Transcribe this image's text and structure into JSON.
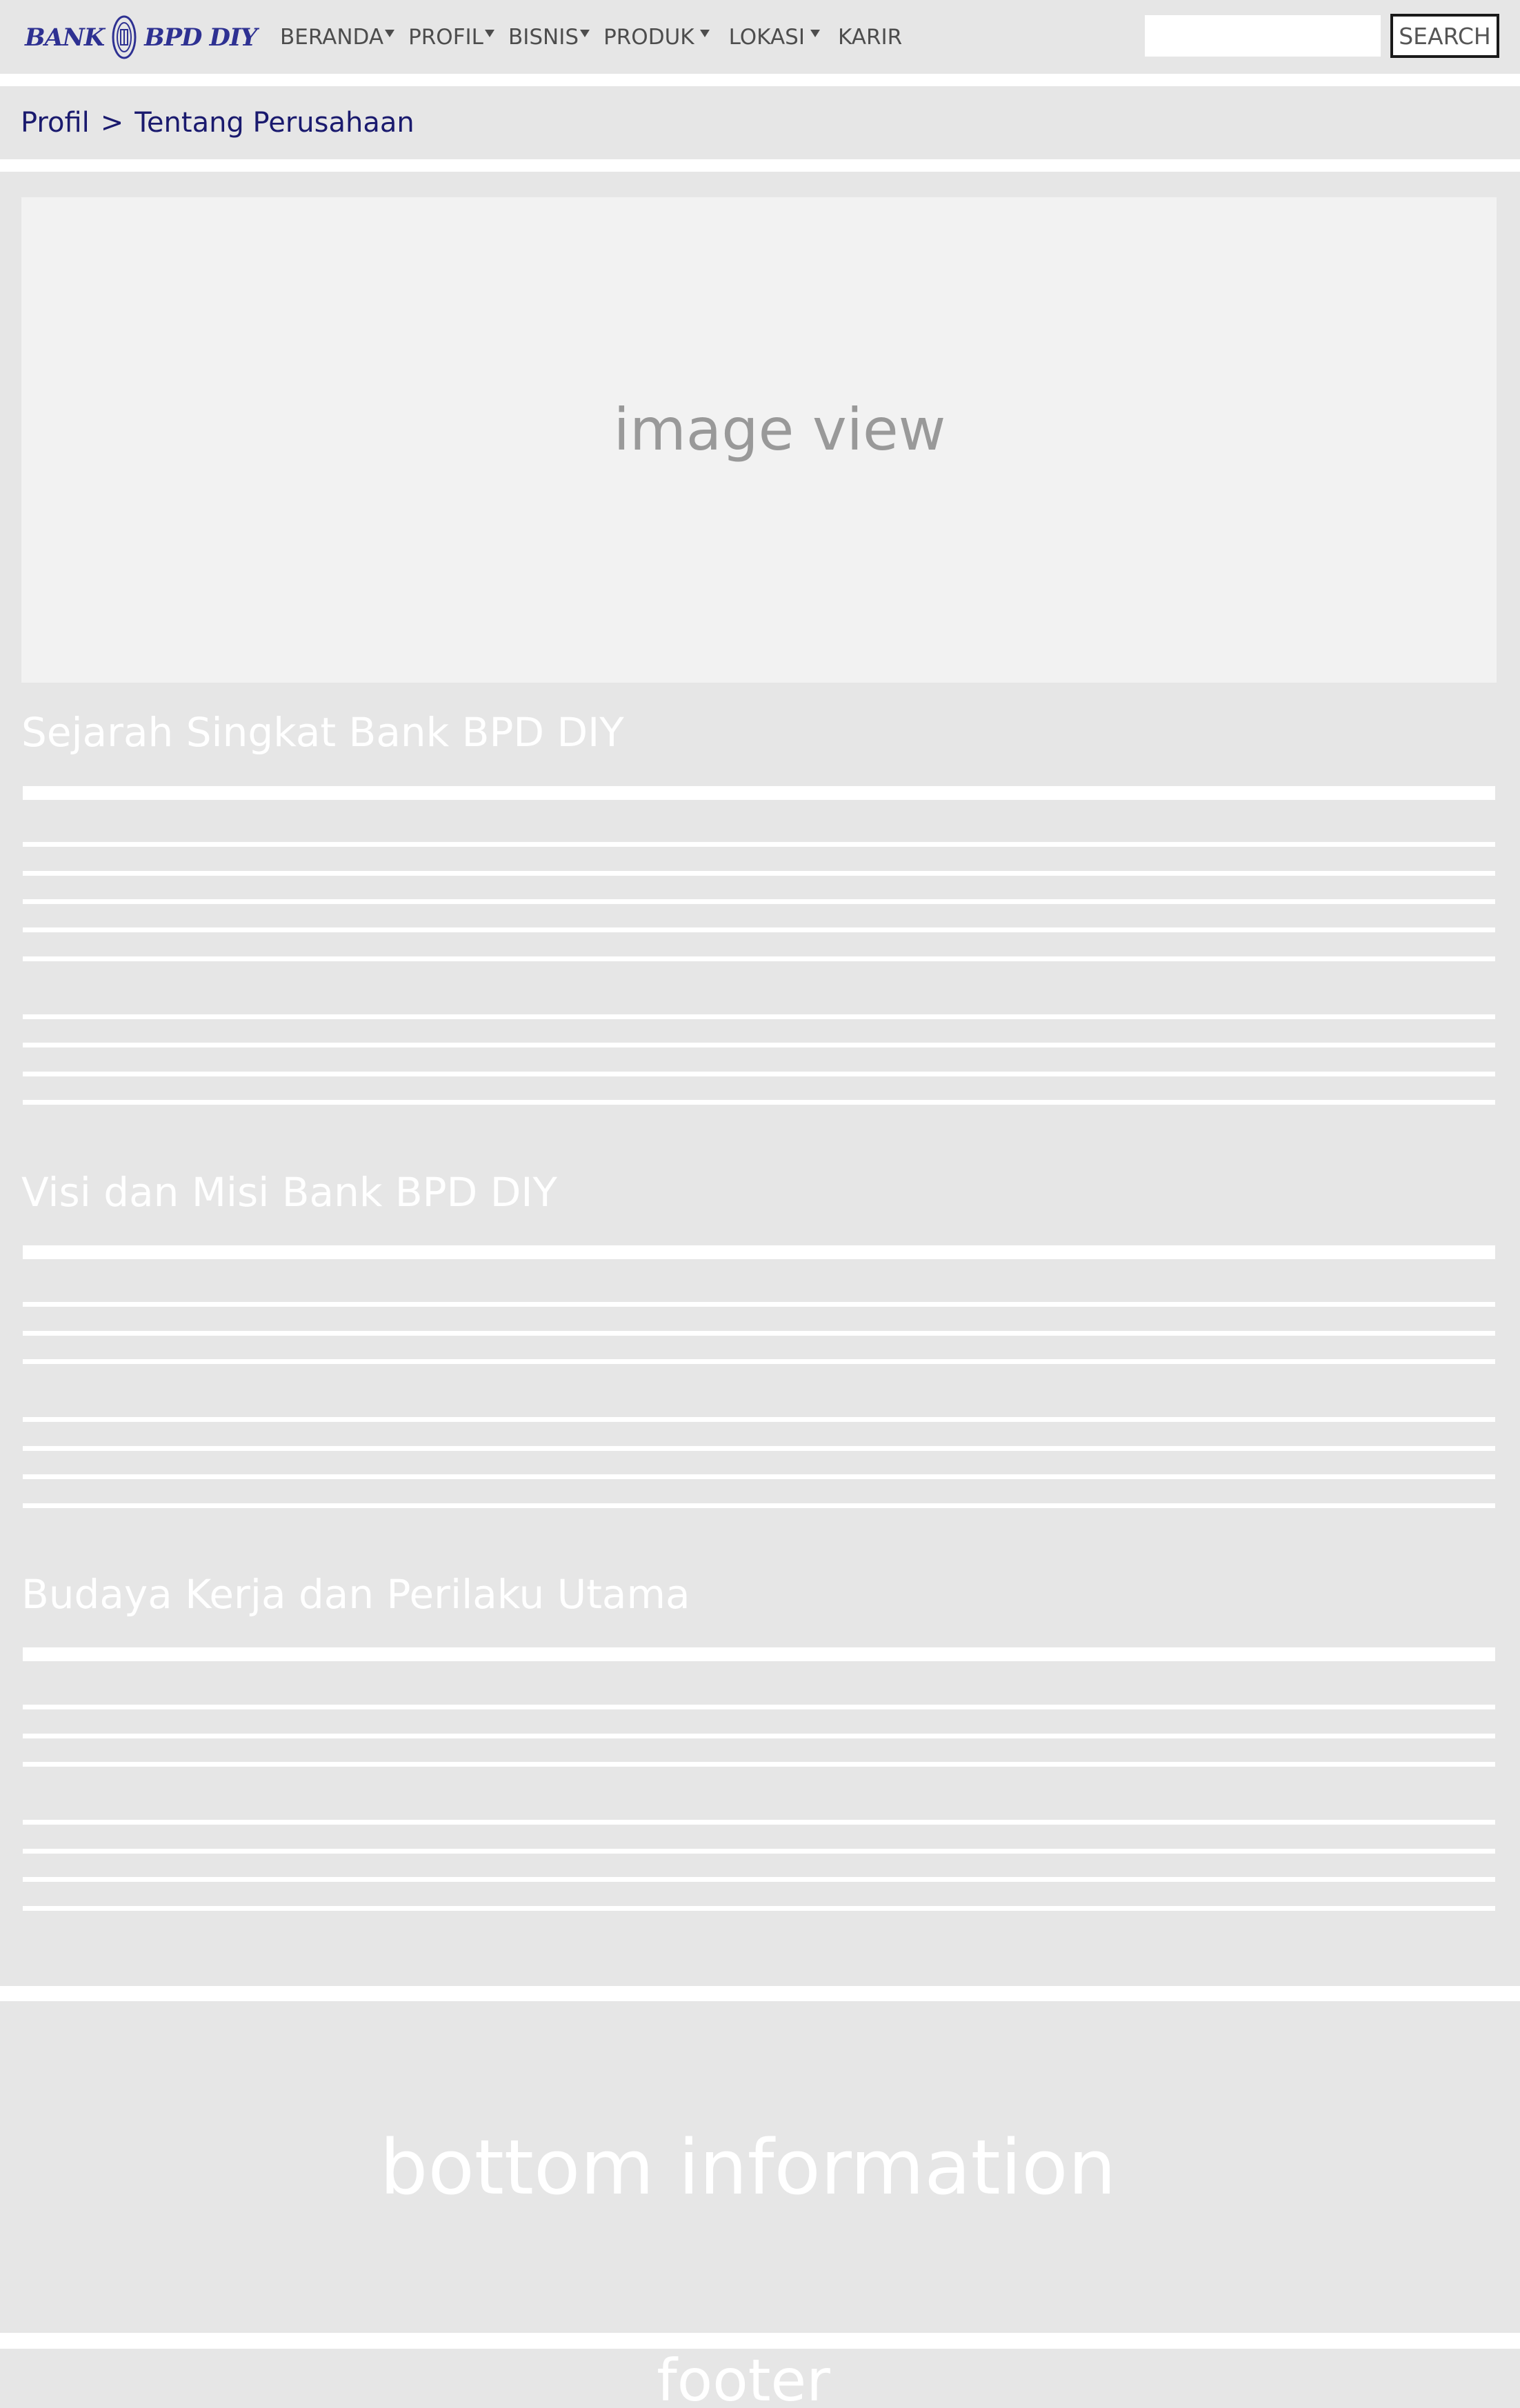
{
  "header": {
    "logo": {
      "left": "BANK",
      "right": "BPD DIY",
      "emblem": "bank-bpd-diy-emblem"
    },
    "nav": [
      {
        "label": "BERANDA",
        "has_dropdown": true
      },
      {
        "label": "PROFIL",
        "has_dropdown": true
      },
      {
        "label": "BISNIS",
        "has_dropdown": true
      },
      {
        "label": "PRODUK",
        "has_dropdown": true
      },
      {
        "label": "LOKASI",
        "has_dropdown": true
      },
      {
        "label": "KARIR",
        "has_dropdown": false
      }
    ],
    "search": {
      "value": "",
      "placeholder": "",
      "button_label": "SEARCH"
    }
  },
  "breadcrumb": {
    "items": [
      "Profil",
      "Tentang Perusahaan"
    ],
    "separator": ">"
  },
  "main": {
    "image_placeholder": "image view",
    "sections": [
      {
        "title": "Sejarah Singkat Bank BPD DIY"
      },
      {
        "title": "Visi dan Misi Bank BPD DIY"
      },
      {
        "title": "Budaya Kerja dan Perilaku Utama"
      }
    ]
  },
  "bottom_information": {
    "label": "bottom information"
  },
  "footer": {
    "label": "footer"
  },
  "colors": {
    "panel": "#e6e6e6",
    "image_placeholder": "#f2f2f2",
    "logo": "#2e3192",
    "breadcrumb": "#1a1a6e",
    "nav_text": "#4d4d4d",
    "skeleton_line": "#ffffff"
  }
}
